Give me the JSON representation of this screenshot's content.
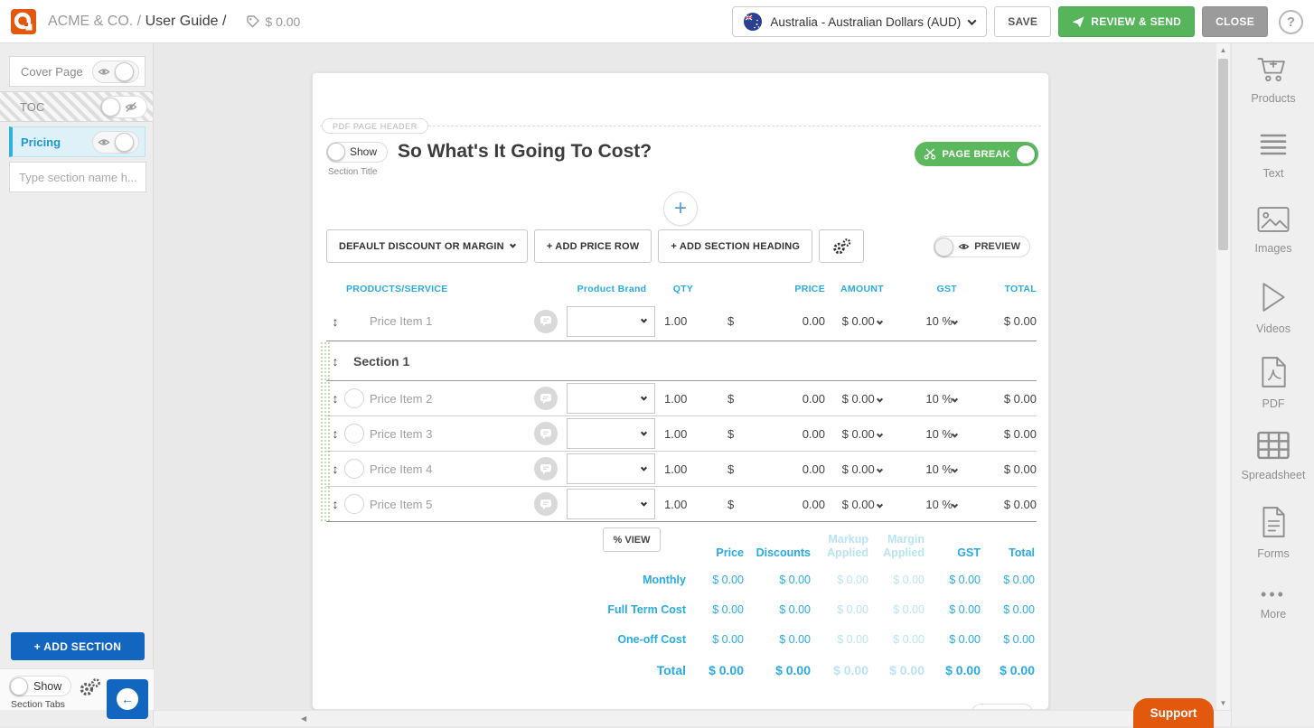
{
  "icons": {
    "help": "?",
    "scroll_up": "▲",
    "scroll_down": "▼",
    "scroll_left": "◀",
    "drag": "↕",
    "more": "•••",
    "plus": "+"
  },
  "colors": {
    "accent_orange": "#e2580c",
    "green": "#56b45a",
    "primary_blue": "#1266c0",
    "table_blue": "#29abe2"
  },
  "topbar": {
    "company": "ACME & CO. /",
    "page": "User Guide /",
    "tag_amount": "$ 0.00",
    "currency_selector": "Australia - Australian Dollars (AUD)",
    "save": "SAVE",
    "review_send": "REVIEW & SEND",
    "close": "CLOSE"
  },
  "sidebar": {
    "tabs": [
      {
        "label": "Cover Page"
      },
      {
        "label": "TOC"
      },
      {
        "label": "Pricing"
      }
    ],
    "new_section_placeholder": "Type section name h...",
    "add_section": "+ ADD SECTION",
    "show": "Show",
    "section_tabs": "Section Tabs"
  },
  "editor": {
    "pdf_header": "PDF PAGE HEADER",
    "show": "Show",
    "section_title": "So What's It Going To Cost?",
    "section_title_caption": "Section Title",
    "page_break": "PAGE BREAK",
    "toolbar": {
      "default_discount": "DEFAULT DISCOUNT OR MARGIN",
      "add_price_row": "+ ADD PRICE ROW",
      "add_section_heading": "+ ADD SECTION HEADING",
      "preview": "PREVIEW"
    },
    "table": {
      "headers": [
        "PRODUCTS/SERVICE",
        "Product Brand",
        "QTY",
        "PRICE",
        "AMOUNT",
        "GST",
        "TOTAL"
      ],
      "section_heading": "Section 1",
      "rows": [
        {
          "name": "Price Item 1",
          "qty": "1.00",
          "currency": "$",
          "price": "0.00",
          "amount": "$ 0.00",
          "gst": "10 %",
          "total": "$ 0.00"
        },
        {
          "name": "Price Item 2",
          "qty": "1.00",
          "currency": "$",
          "price": "0.00",
          "amount": "$ 0.00",
          "gst": "10 %",
          "total": "$ 0.00"
        },
        {
          "name": "Price Item 3",
          "qty": "1.00",
          "currency": "$",
          "price": "0.00",
          "amount": "$ 0.00",
          "gst": "10 %",
          "total": "$ 0.00"
        },
        {
          "name": "Price Item 4",
          "qty": "1.00",
          "currency": "$",
          "price": "0.00",
          "amount": "$ 0.00",
          "gst": "10 %",
          "total": "$ 0.00"
        },
        {
          "name": "Price Item 5",
          "qty": "1.00",
          "currency": "$",
          "price": "0.00",
          "amount": "$ 0.00",
          "gst": "10 %",
          "total": "$ 0.00"
        }
      ]
    },
    "summary": {
      "view_toggle": "% VIEW",
      "columns": [
        "Price",
        "Discounts",
        "Markup Applied",
        "Margin Applied",
        "GST",
        "Total"
      ],
      "rows": [
        {
          "label": "Monthly",
          "values": [
            "$ 0.00",
            "$ 0.00",
            "$ 0.00",
            "$ 0.00",
            "$ 0.00",
            "$ 0.00"
          ]
        },
        {
          "label": "Full Term Cost",
          "values": [
            "$ 0.00",
            "$ 0.00",
            "$ 0.00",
            "$ 0.00",
            "$ 0.00",
            "$ 0.00"
          ]
        },
        {
          "label": "One-off Cost",
          "values": [
            "$ 0.00",
            "$ 0.00",
            "$ 0.00",
            "$ 0.00",
            "$ 0.00",
            "$ 0.00"
          ]
        },
        {
          "label": "Total",
          "values": [
            "$ 0.00",
            "$ 0.00",
            "$ 0.00",
            "$ 0.00",
            "$ 0.00",
            "$ 0.00"
          ]
        }
      ]
    }
  },
  "toolbox": {
    "items": [
      {
        "label": "Products"
      },
      {
        "label": "Text"
      },
      {
        "label": "Images"
      },
      {
        "label": "Videos"
      },
      {
        "label": "PDF"
      },
      {
        "label": "Spreadsheet"
      },
      {
        "label": "Forms"
      },
      {
        "label": "More"
      }
    ]
  },
  "support": {
    "label": "Support"
  }
}
